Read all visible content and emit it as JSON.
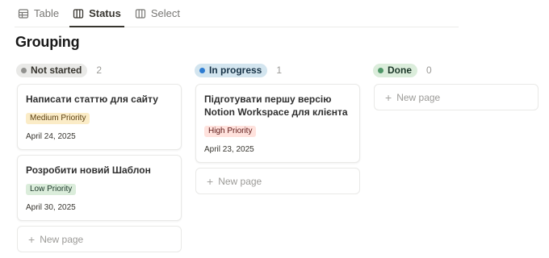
{
  "tabs": [
    {
      "label": "Table",
      "icon": "table-icon",
      "active": false
    },
    {
      "label": "Status",
      "icon": "board-icon",
      "active": true
    },
    {
      "label": "Select",
      "icon": "board-icon",
      "active": false
    }
  ],
  "title": "Grouping",
  "columns": [
    {
      "label": "Not started",
      "count": "2",
      "pill_bg": "#e9e9e7",
      "pill_color": "#37352f",
      "dot": "#91918e",
      "cards": [
        {
          "title": "Написати статтю для сайту",
          "tag": "Medium Priority",
          "tag_bg": "#fbecc7",
          "tag_color": "#5c4012",
          "date": "April 24, 2025"
        },
        {
          "title": "Розробити новий Шаблон",
          "tag": "Low Priority",
          "tag_bg": "#dbeddb",
          "tag_color": "#1c3829",
          "date": "April 30, 2025"
        }
      ],
      "new_page": "New page"
    },
    {
      "label": "In progress",
      "count": "1",
      "pill_bg": "#d3e5ef",
      "pill_color": "#183347",
      "dot": "#2e7cd1",
      "cards": [
        {
          "title": "Підготувати першу версію Notion Workspace для клієнта",
          "tag": "High Priority",
          "tag_bg": "#ffe2dd",
          "tag_color": "#5d1715",
          "date": "April 23, 2025"
        }
      ],
      "new_page": "New page"
    },
    {
      "label": "Done",
      "count": "0",
      "pill_bg": "#dbeddb",
      "pill_color": "#1c3829",
      "dot": "#4f9768",
      "cards": [],
      "new_page": "New page"
    }
  ]
}
